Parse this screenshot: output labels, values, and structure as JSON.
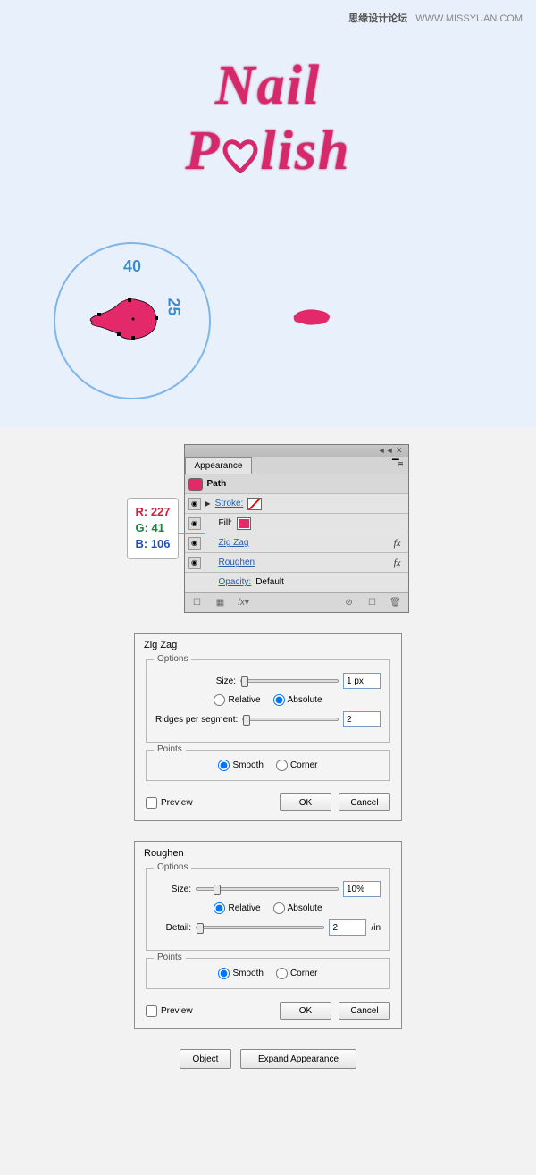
{
  "watermark": {
    "cn": "思缘设计论坛",
    "url": "WWW.MISSYUAN.COM"
  },
  "artwork": {
    "line1": "Nail",
    "line2_pre": "P",
    "line2_post": "lish",
    "circle_w": "40",
    "circle_h": "25"
  },
  "rgb": {
    "r": "R: 227",
    "g": "G: 41",
    "b": "B: 106"
  },
  "appearance": {
    "tab": "Appearance",
    "header": "Path",
    "stroke_label": "Stroke:",
    "fill_label": "Fill:",
    "zigzag": "Zig Zag",
    "roughen": "Roughen",
    "opacity_label": "Opacity:",
    "opacity_value": "Default",
    "top_icons": "◄◄  ✕",
    "menu": "▔≡"
  },
  "zigzag_dialog": {
    "title": "Zig Zag",
    "options": "Options",
    "size": "Size:",
    "size_val": "1 px",
    "relative": "Relative",
    "absolute": "Absolute",
    "ridges": "Ridges per segment:",
    "ridges_val": "2",
    "points": "Points",
    "smooth": "Smooth",
    "corner": "Corner",
    "preview": "Preview",
    "ok": "OK",
    "cancel": "Cancel"
  },
  "roughen_dialog": {
    "title": "Roughen",
    "options": "Options",
    "size": "Size:",
    "size_val": "10%",
    "relative": "Relative",
    "absolute": "Absolute",
    "detail": "Detail:",
    "detail_val": "2",
    "detail_unit": "/in",
    "points": "Points",
    "smooth": "Smooth",
    "corner": "Corner",
    "preview": "Preview",
    "ok": "OK",
    "cancel": "Cancel"
  },
  "bottom": {
    "object": "Object",
    "expand": "Expand Appearance"
  }
}
